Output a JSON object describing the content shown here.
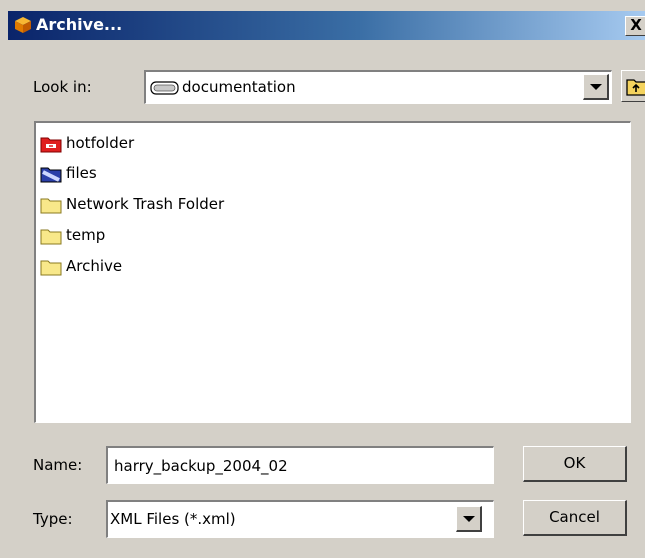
{
  "window": {
    "title": "Archive...",
    "close_label": "X"
  },
  "lookin": {
    "label": "Look in:",
    "value": "documentation"
  },
  "files": [
    {
      "name": "hotfolder",
      "icon": "hotfolder-icon"
    },
    {
      "name": "files",
      "icon": "blue-folder-icon"
    },
    {
      "name": "Network Trash Folder",
      "icon": "folder-icon"
    },
    {
      "name": "temp",
      "icon": "folder-icon"
    },
    {
      "name": "Archive",
      "icon": "folder-icon"
    }
  ],
  "name_field": {
    "label": "Name:",
    "value": "harry_backup_2004_02"
  },
  "type_field": {
    "label": "Type:",
    "value": "XML Files (*.xml)"
  },
  "buttons": {
    "ok": "OK",
    "cancel": "Cancel"
  },
  "colors": {
    "face": "#d4d0c8",
    "title_dark": "#0a246a",
    "title_light": "#a6caf0"
  }
}
